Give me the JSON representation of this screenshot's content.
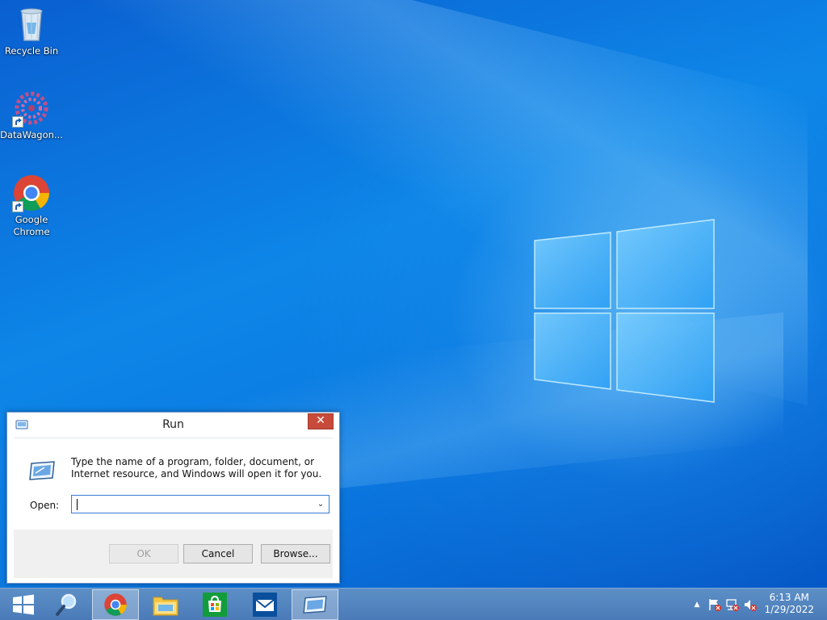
{
  "desktop": {
    "icons": [
      {
        "label": "Recycle Bin"
      },
      {
        "label": "DataWagon..."
      },
      {
        "label": "Google Chrome"
      }
    ]
  },
  "run_dialog": {
    "title": "Run",
    "close_glyph": "✕",
    "description": "Type the name of a program, folder, document, or Internet resource, and Windows will open it for you.",
    "open_label": "Open:",
    "open_value": "",
    "dropdown_glyph": "⌄",
    "buttons": {
      "ok": "OK",
      "cancel": "Cancel",
      "browse": "Browse..."
    }
  },
  "taskbar": {
    "pinned": [
      "start-icon",
      "search-icon",
      "chrome-icon",
      "file-explorer-icon",
      "store-icon",
      "mail-icon",
      "run-icon"
    ],
    "tray": {
      "chevron": "▲",
      "time": "6:13 AM",
      "date": "1/29/2022"
    }
  },
  "colors": {
    "desktop_blue": "#0b78e0",
    "taskbar": "#4a7bb8",
    "close_red": "#c74a3a",
    "input_focus": "#3a7bd5"
  }
}
